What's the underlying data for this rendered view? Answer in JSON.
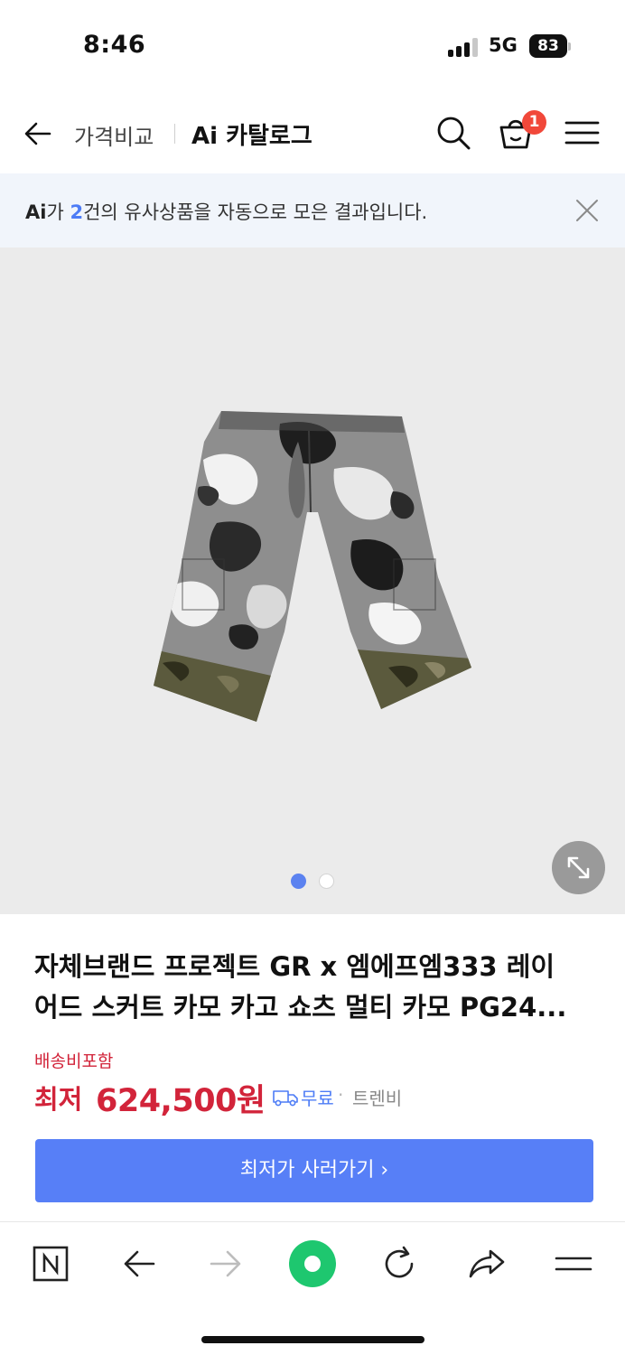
{
  "status_bar": {
    "time": "8:46",
    "network": "5G",
    "battery": "83"
  },
  "header": {
    "breadcrumb": "가격비교",
    "title": "Ai 카탈로그",
    "cart_count": "1",
    "icons": {
      "back": "back-arrow-icon",
      "search": "search-icon",
      "cart": "shopping-bag-icon",
      "menu": "hamburger-menu-icon"
    }
  },
  "banner": {
    "ai_mark": "Ai",
    "text_before_count": "가 ",
    "count": "2",
    "text_after_count": "건의 유사상품을 자동으로 모은 결과입니다.",
    "close_icon": "close-icon"
  },
  "gallery": {
    "total_images": 2,
    "active_index": 0,
    "expand_icon": "expand-icon"
  },
  "product": {
    "title_line1": "자체브랜드 프로젝트 GR x 엠에프엠333 레이",
    "title_line2": "어드 스커트 카모 카고 쇼츠 멀티 카모 PG24...",
    "shipping_included": "배송비포함",
    "price_prefix": "최저",
    "price": "624,500원",
    "shipping": "무료",
    "separator": "·",
    "seller": "트렌비"
  },
  "buy_button": {
    "label": "최저가 사러가기 ›"
  },
  "bottom_nav": {
    "icons": [
      "naver-n-icon",
      "back-arrow-icon",
      "forward-arrow-icon",
      "green-dot-icon",
      "refresh-icon",
      "share-icon",
      "menu-icon"
    ]
  },
  "colors": {
    "accent_blue": "#577ff7",
    "price_red": "#d2243a",
    "badge_red": "#f1483a",
    "green": "#1ec76f"
  }
}
